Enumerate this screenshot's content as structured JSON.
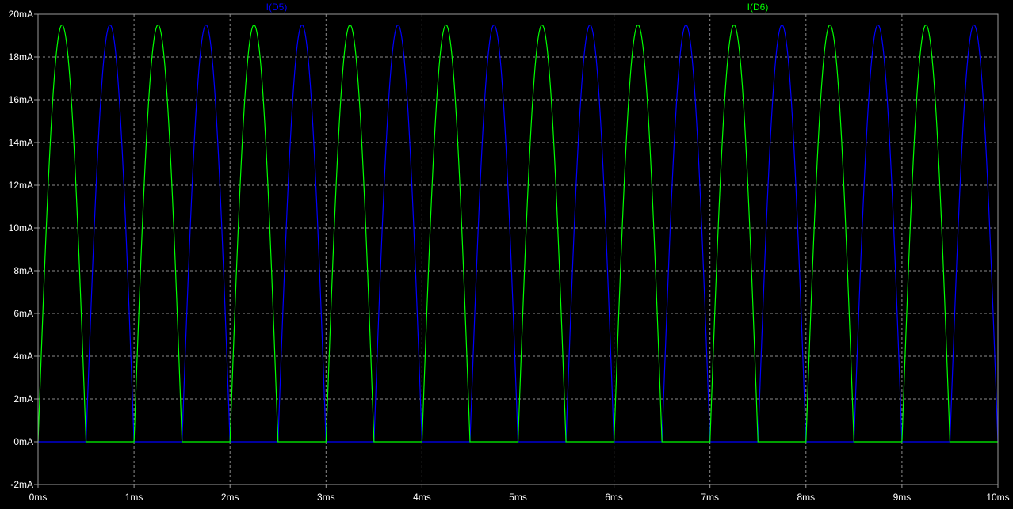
{
  "chart_data": {
    "type": "line",
    "xlim": [
      0,
      10
    ],
    "ylim": [
      -2,
      20
    ],
    "x_ticks": [
      0,
      1,
      2,
      3,
      4,
      5,
      6,
      7,
      8,
      9,
      10
    ],
    "x_tick_labels": [
      "0ms",
      "1ms",
      "2ms",
      "3ms",
      "4ms",
      "5ms",
      "6ms",
      "7ms",
      "8ms",
      "9ms",
      "10ms"
    ],
    "y_ticks": [
      -2,
      0,
      2,
      4,
      6,
      8,
      10,
      12,
      14,
      16,
      18,
      20
    ],
    "y_tick_labels": [
      "-2mA",
      "0mA",
      "2mA",
      "4mA",
      "6mA",
      "8mA",
      "10mA",
      "12mA",
      "14mA",
      "16mA",
      "18mA",
      "20mA"
    ],
    "grid": true,
    "series": [
      {
        "name": "I(D5)",
        "color": "#0000ff",
        "period_ms": 0.5,
        "peak_mA": 19.5,
        "pulses_start_ms": [
          0.5,
          1.5,
          2.5,
          3.5,
          4.5,
          5.5,
          6.5,
          7.5,
          8.5,
          9.5
        ],
        "pulse_width_ms": 0.5
      },
      {
        "name": "I(D6)",
        "color": "#00ff00",
        "period_ms": 0.5,
        "peak_mA": 19.5,
        "pulses_start_ms": [
          0.0,
          1.0,
          2.0,
          3.0,
          4.0,
          5.0,
          6.0,
          7.0,
          8.0,
          9.0
        ],
        "pulse_width_ms": 0.5
      }
    ],
    "legend_placement": "top"
  },
  "colors": {
    "background": "#000000",
    "frame": "#9a9a9a",
    "grid": "#8c8c8c",
    "tick_text": "#ffffff"
  }
}
